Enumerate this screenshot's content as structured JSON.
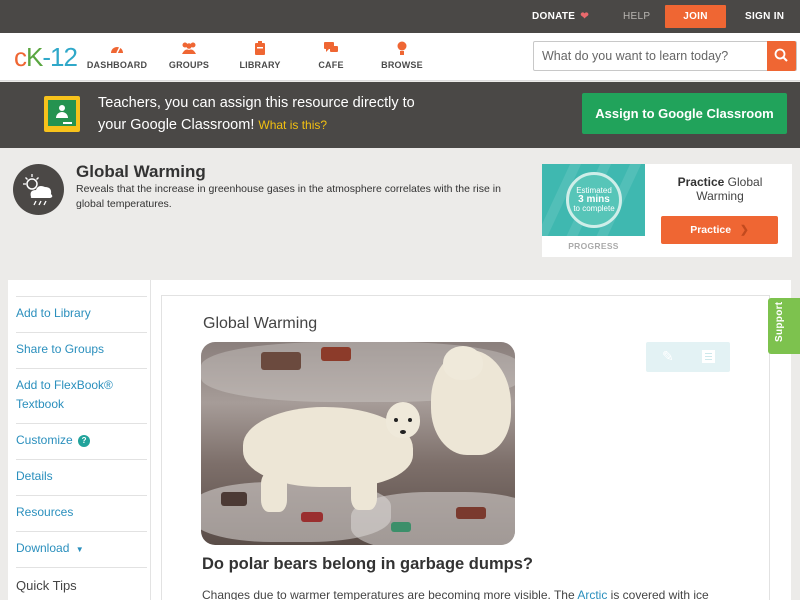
{
  "topbar": {
    "donate": "DONATE",
    "help": "HELP",
    "join": "JOIN",
    "signin": "SIGN IN"
  },
  "logo": {
    "c": "c",
    "k": "K",
    "n": "-12"
  },
  "nav": {
    "items": [
      {
        "label": "DASHBOARD",
        "icon": "dashboard-icon"
      },
      {
        "label": "GROUPS",
        "icon": "groups-icon"
      },
      {
        "label": "LIBRARY",
        "icon": "library-icon"
      },
      {
        "label": "CAFE",
        "icon": "cafe-icon"
      },
      {
        "label": "BROWSE",
        "icon": "browse-icon"
      }
    ],
    "search_placeholder": "What do you want to learn today?"
  },
  "classroom": {
    "line1": "Teachers, you can assign this resource directly to",
    "line2": "your Google Classroom!",
    "what": "What is this?",
    "button": "Assign to Google Classroom"
  },
  "concept": {
    "title": "Global Warming",
    "description": "Reveals that the increase in greenhouse gases in the atmosphere correlates with the rise in global temperatures."
  },
  "practice": {
    "estimated": "Estimated",
    "mins": "3 mins",
    "to_complete": "to complete",
    "progress": "PROGRESS",
    "label_bold": "Practice",
    "label_rest": "Global Warming",
    "button": "Practice"
  },
  "sidebar": {
    "add_library": "Add to Library",
    "share_groups": "Share to Groups",
    "add_flexbook_1": "Add to FlexBook®",
    "add_flexbook_2": "Textbook",
    "customize": "Customize",
    "details": "Details",
    "resources": "Resources",
    "download": "Download",
    "quick_tips": "Quick Tips"
  },
  "content": {
    "title": "Global Warming",
    "question": "Do polar bears belong in garbage dumps?",
    "para_start": "Changes due to warmer temperatures are becoming more visible. The ",
    "para_link": "Arctic",
    "para_end": " is covered with ice"
  },
  "support": "Support",
  "colors": {
    "accent_orange": "#ef6633",
    "green_button": "#21a35b",
    "link_blue": "#2a8fbd",
    "dark_bar": "#4a4846"
  }
}
